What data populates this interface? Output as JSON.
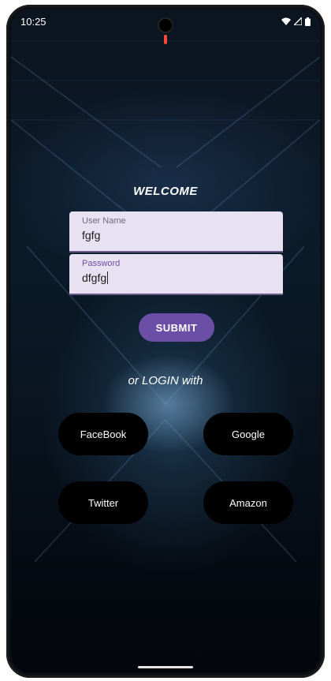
{
  "status_bar": {
    "time": "10:25",
    "wifi_icon": "wifi-icon",
    "signal_icon": "signal-icon",
    "battery_icon": "battery-icon"
  },
  "login": {
    "welcome": "WELCOME",
    "username": {
      "label": "User Name",
      "value": "fgfg"
    },
    "password": {
      "label": "Password",
      "value": "dfgfg"
    },
    "submit_label": "SUBMIT",
    "or_login_with": "or LOGIN with"
  },
  "social": {
    "facebook": "FaceBook",
    "google": "Google",
    "twitter": "Twitter",
    "amazon": "Amazon"
  },
  "colors": {
    "accent": "#6b4fa6",
    "field_bg": "#e8e1f1",
    "social_bg": "#000000"
  }
}
